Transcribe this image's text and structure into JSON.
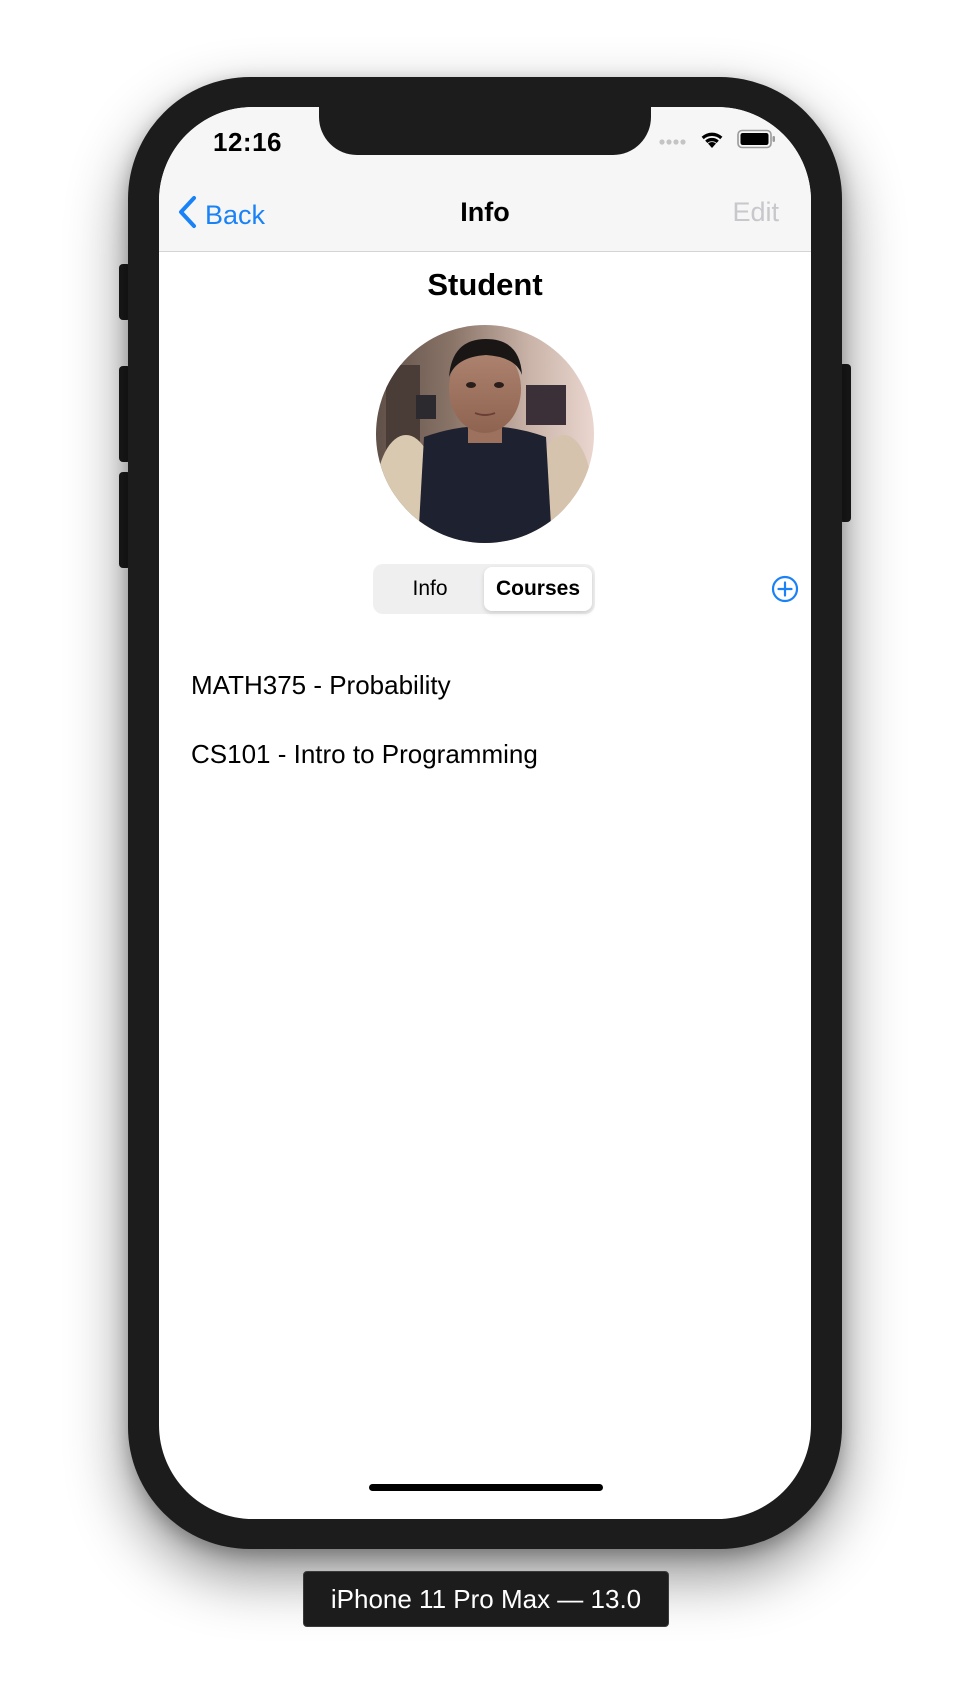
{
  "status_bar": {
    "time": "12:16",
    "icons": [
      "cellular-signal-icon",
      "wifi-icon",
      "battery-icon"
    ]
  },
  "nav": {
    "back_label": "Back",
    "title": "Info",
    "edit_label": "Edit"
  },
  "profile": {
    "heading": "Student",
    "photo": "student-photo"
  },
  "segmented_control": {
    "segments": [
      "Info",
      "Courses"
    ],
    "selected": "Courses"
  },
  "add_button": {
    "icon": "plus-circle-icon"
  },
  "courses": [
    "MATH375 - Probability",
    "CS101 - Intro to Programming"
  ],
  "device_label": "iPhone 11 Pro Max — 13.0",
  "colors": {
    "tint": "#1a82f7",
    "disabled": "#c7c7cc",
    "bar_background": "#f6f6f6",
    "device_frame": "#1c1c1c"
  }
}
